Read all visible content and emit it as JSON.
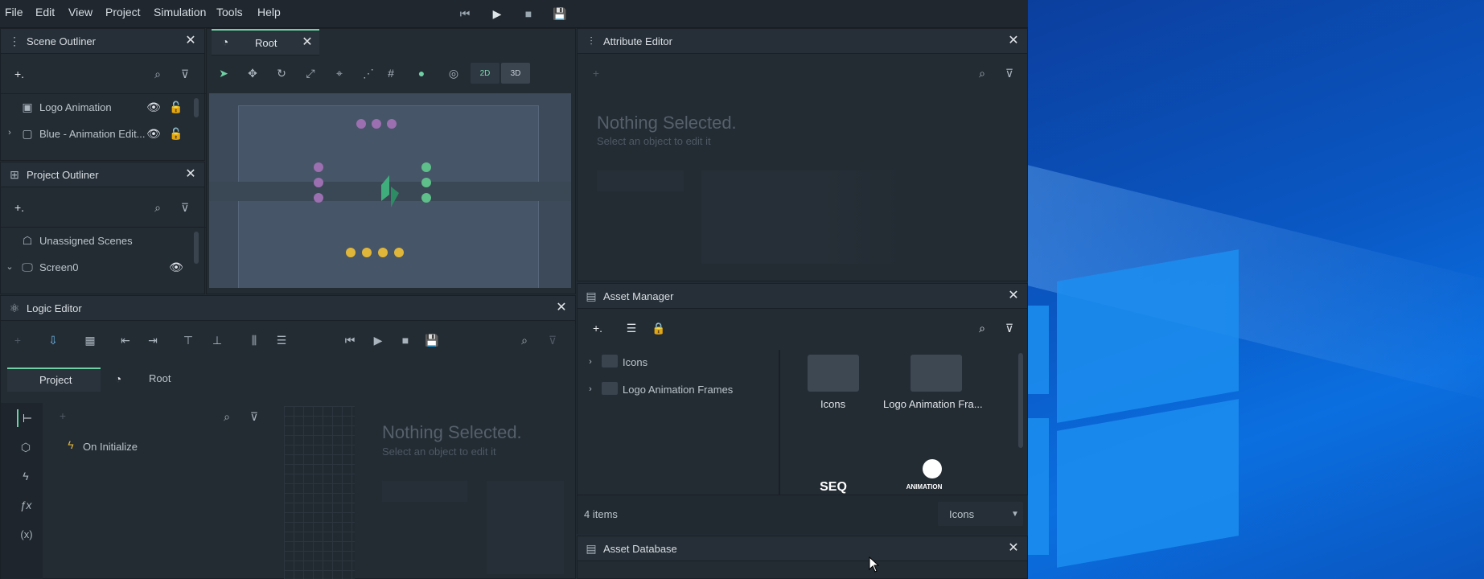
{
  "menubar": {
    "items": [
      "File",
      "Edit",
      "View",
      "Project",
      "Simulation",
      "Tools",
      "Help"
    ]
  },
  "scene_outliner": {
    "title": "Scene Outliner",
    "rows": [
      {
        "label": "Logo Animation"
      },
      {
        "label": "Blue - Animation Edit..."
      }
    ]
  },
  "project_outliner": {
    "title": "Project Outliner",
    "rows": [
      {
        "label": "Unassigned Scenes"
      },
      {
        "label": "Screen0"
      }
    ]
  },
  "viewport": {
    "tab_label": "Root",
    "mode_2d": "2D",
    "mode_3d": "3D"
  },
  "logic_editor": {
    "title": "Logic Editor",
    "tabs": [
      "Project",
      "Root"
    ],
    "tree_item": "On Initialize",
    "nothing_title": "Nothing Selected.",
    "nothing_sub": "Select an object to edit it"
  },
  "attribute_editor": {
    "title": "Attribute Editor",
    "nothing_title": "Nothing Selected.",
    "nothing_sub": "Select an object to edit it"
  },
  "asset_manager": {
    "title": "Asset Manager",
    "tree": [
      "Icons",
      "Logo Animation Frames"
    ],
    "grid": [
      {
        "label": "Icons",
        "kind": "folder"
      },
      {
        "label": "Logo Animation Fra...",
        "kind": "folder"
      },
      {
        "label": "SEQ",
        "kind": "seq-file"
      },
      {
        "label": "ANIMATION",
        "kind": "animation-file"
      }
    ],
    "count": "4 items",
    "filter_value": "Icons"
  },
  "asset_database": {
    "title": "Asset Database"
  },
  "colors": {
    "accent": "#6fd0a4",
    "purple_dot": "#9b6fb0",
    "green_dot": "#5fbf8a",
    "yellow_dot": "#e0b63a"
  }
}
